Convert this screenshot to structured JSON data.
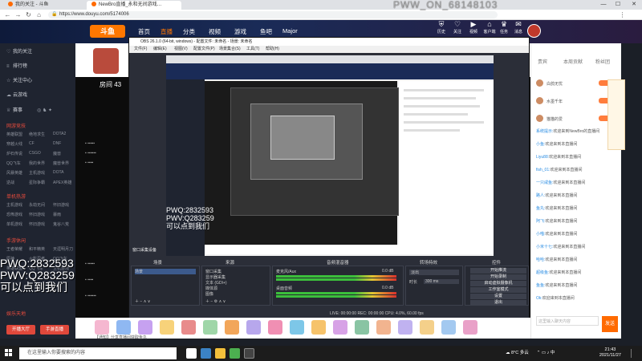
{
  "browser": {
    "tabs": [
      "我的关注 - 斗鱼",
      "NewBro直播_永和无间游戏…"
    ],
    "url": "https://www.douyu.com/5174006",
    "watermark": "PWW_ON_68148103"
  },
  "header": {
    "logo": "斗鱼",
    "nav": [
      "首页",
      "直播",
      "分类",
      "视频",
      "游戏",
      "鱼吧",
      "Major"
    ],
    "icons": [
      {
        "icon": "shield-icon",
        "label": "历史"
      },
      {
        "icon": "heart-icon",
        "label": "关注"
      },
      {
        "icon": "video-icon",
        "label": "视频"
      },
      {
        "icon": "gift-icon",
        "label": "客户端"
      },
      {
        "icon": "trophy-icon",
        "label": "任务"
      },
      {
        "icon": "bell-icon",
        "label": "消息"
      },
      {
        "icon": "crown-icon",
        "label": "会员"
      }
    ]
  },
  "sidebar": {
    "items": [
      {
        "icon": "heart",
        "label": "我的关注"
      },
      {
        "icon": "list",
        "label": "排行榜"
      },
      {
        "icon": "star",
        "label": "关注中心"
      },
      {
        "icon": "cloud",
        "label": "云游戏"
      }
    ],
    "icon_row": [
      "赛事"
    ],
    "section1": {
      "title": "网游竞技",
      "cells": [
        "英雄联盟",
        "绝地求生",
        "DOTA2",
        "穿越火线",
        "CF",
        "DNF",
        "炉石传说",
        "CSGO",
        "魔兽",
        "QQ飞车",
        "我的世界",
        "魔兽世界",
        "风暴英雄",
        "主机游戏",
        "DOTA",
        "逆战",
        "星际争霸",
        "APEX英雄"
      ]
    },
    "section2": {
      "title": "单机热游",
      "cells": [
        "主机游戏",
        "永劫无间",
        "怀旧游戏",
        "恐怖游戏",
        "怀旧游戏",
        "暴雨",
        "单机游戏",
        "怀旧游戏",
        "鬼谷八荒"
      ]
    },
    "section3": {
      "title": "手游休闲",
      "cells": [
        "王者荣耀",
        "和平精英",
        "天涯明月刀",
        "原神",
        "火影忍者",
        "QQ飞车",
        "英雄联盟",
        "QQ飞车",
        "主机游戏"
      ]
    },
    "section4": {
      "title": "娱乐天地"
    },
    "buttons": [
      "开播大厅",
      "手游直播"
    ]
  },
  "room": {
    "room_number": "房间 43",
    "pwq1": "PWQ:2832593",
    "pwq2": "PWV:Q283259",
    "slogan": "可以点到我们"
  },
  "obs": {
    "title": "OBS 26.1.0 (64-bit, windows) - 配置文件: 未命名 - 场景: 未命名",
    "menu": [
      "文件(F)",
      "编辑(E)",
      "视图(V)",
      "配置文件(P)",
      "场景集合(S)",
      "工具(T)",
      "帮助(H)"
    ],
    "dock_labels": [
      "场景",
      "来源",
      "音频混音器",
      "转场特效",
      "控件"
    ],
    "scene_items": [
      "场景"
    ],
    "source_items": [
      "窗口采集",
      "显示器采集",
      "文本 (GDI+)",
      "媒体源",
      "图像"
    ],
    "mixer": [
      {
        "name": "麦克风/Aux",
        "db": "0.0 dB"
      },
      {
        "name": "桌面音频",
        "db": "0.0 dB"
      }
    ],
    "transition": {
      "type": "淡出",
      "duration_label": "时长",
      "duration": "300 ms"
    },
    "controls": [
      "开始推流",
      "开始录制",
      "启动虚拟摄像机",
      "工作室模式",
      "设置",
      "退出"
    ],
    "status": "LIVE: 00:00:00    REC: 00:00:00    CPU: 4.0%, 60.00 fps",
    "source_panel_label": "窗口采集设备"
  },
  "inner": {
    "pwq1": "PWQ:2832593",
    "pwq2": "PWV:Q283259",
    "slogan": "可以点到我们"
  },
  "right": {
    "tabs": [
      "贵宾",
      "本周贡献",
      "粉丝团"
    ],
    "ranks": [
      {
        "name": "白鸽无忧"
      },
      {
        "name": "水墨千年"
      },
      {
        "name": "猫猫的爱"
      }
    ],
    "messages": [
      {
        "user": "系统提示:",
        "text": "欢迎来到NewBro的直播间"
      },
      {
        "user": "小鱼:",
        "text": "欢迎来到本直播间"
      },
      {
        "user": "Liyu88:",
        "text": "欢迎来到本直播间"
      },
      {
        "user": "fish_01:",
        "text": "欢迎来到本直播间"
      },
      {
        "user": "一只咸鱼:",
        "text": "欢迎来到本直播间"
      },
      {
        "user": "路人:",
        "text": "欢迎来到本直播间"
      },
      {
        "user": "鱼丸:",
        "text": "欢迎来到本直播间"
      },
      {
        "user": "阿飞:",
        "text": "欢迎来到本直播间"
      },
      {
        "user": "小喵:",
        "text": "欢迎来到本直播间"
      },
      {
        "user": "小米十七:",
        "text": "欢迎来到本直播间"
      },
      {
        "user": "哈哈:",
        "text": "欢迎来到本直播间"
      },
      {
        "user": "超级鱼:",
        "text": "欢迎来到本直播间"
      },
      {
        "user": "鱼鱼:",
        "text": "欢迎来到本直播间"
      },
      {
        "user": "Ok:",
        "text": "欢迎来到本直播间"
      }
    ],
    "input_placeholder": "这里输入聊天内容",
    "send": "发送"
  },
  "giftbar": {
    "tip": "【通知】分享直播间获取鱼丸",
    "gifts": [
      "荧光棒",
      "办卡",
      "小飞碟",
      "鱼丸",
      "火箭",
      "超级火箭",
      "飞机",
      "告白",
      "宝箱",
      "弹幕",
      "跑车",
      "鱼翅",
      "鲨鱼",
      "礼花",
      "冲鸭",
      "亲吻",
      "666",
      "好看"
    ]
  },
  "taskbar": {
    "search_placeholder": "在这里输入你要搜索的内容",
    "tray": "8°C 多云",
    "time": "21:43",
    "date": "2021/11/27"
  },
  "colors": {
    "accent": "#ff7700",
    "sidebar_bg": "#1f2430",
    "header_bg": "#1a2b57",
    "obs_bg": "#2b2e38"
  }
}
